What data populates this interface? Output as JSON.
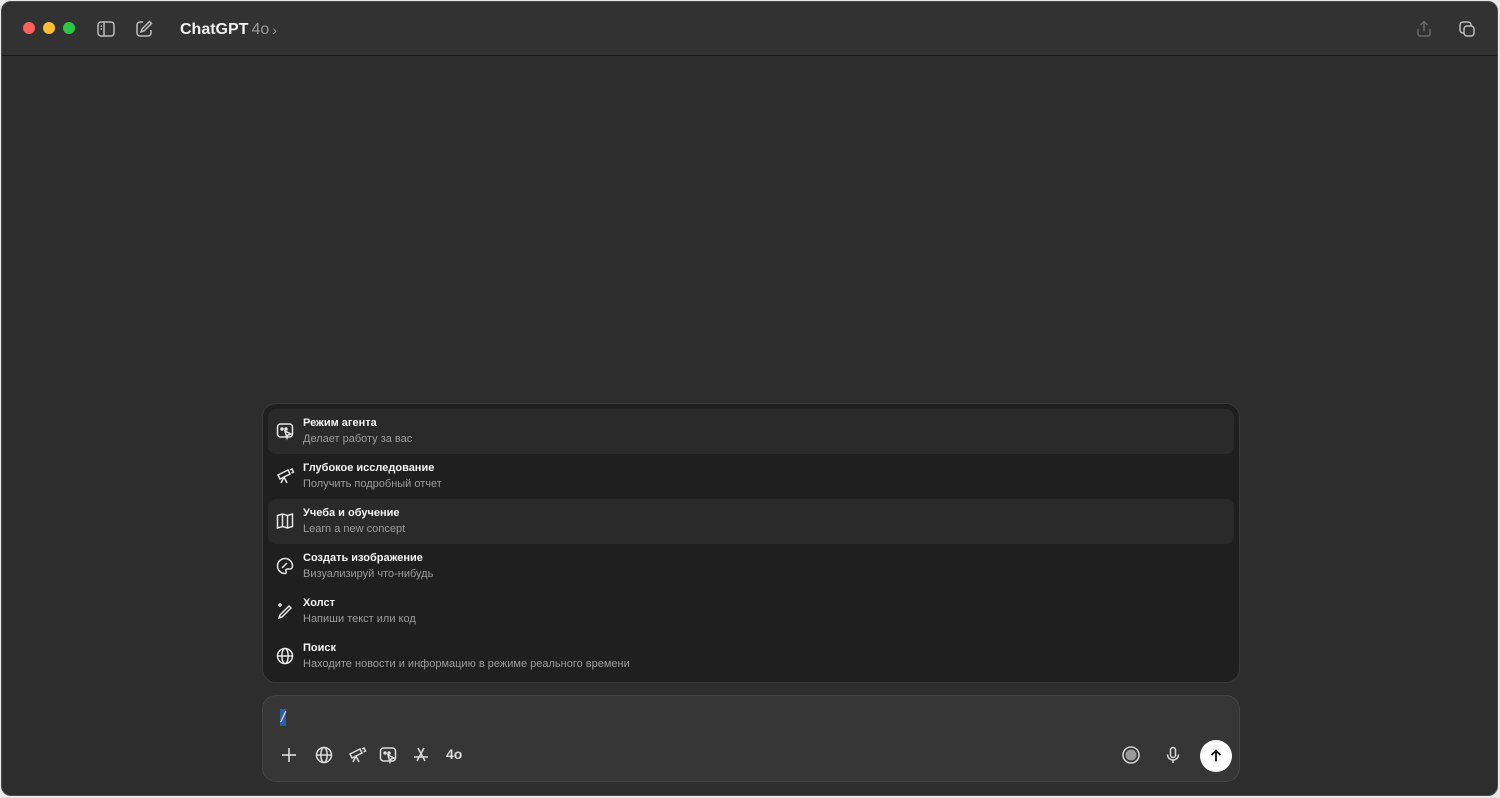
{
  "window": {
    "traffic_lights": [
      "#ff5f57",
      "#febc2e",
      "#28c840"
    ]
  },
  "titlebar": {
    "app_name": "ChatGPT",
    "model_version": "4o",
    "chevron": "›",
    "icons": [
      "sidebar-toggle-icon",
      "new-chat-icon",
      "share-icon",
      "copy-window-icon"
    ]
  },
  "command_menu": {
    "items": [
      {
        "title": "Режим агента",
        "subtitle": "Делает работу за вас",
        "icon": "agent-icon",
        "highlighted": true
      },
      {
        "title": "Глубокое исследование",
        "subtitle": "Получить подробный отчет",
        "icon": "telescope-icon",
        "highlighted": false
      },
      {
        "title": "Учеба и обучение",
        "subtitle": "Learn a new concept",
        "icon": "book-icon",
        "highlighted": true
      },
      {
        "title": "Создать изображение",
        "subtitle": "Визуализируй что-нибудь",
        "icon": "palette-icon",
        "highlighted": false
      },
      {
        "title": "Холст",
        "subtitle": "Напиши текст или код",
        "icon": "pencil-sparkle-icon",
        "highlighted": false
      },
      {
        "title": "Поиск",
        "subtitle": "Находите новости и информацию в режиме реального времени",
        "icon": "globe-icon",
        "highlighted": false
      }
    ]
  },
  "composer": {
    "input_value": "/",
    "model_label": "4o",
    "tool_icons": [
      "plus-icon",
      "globe-icon",
      "telescope-icon",
      "agent-icon",
      "app-store-icon"
    ],
    "right_icons": [
      "voice-mode-icon",
      "microphone-icon"
    ],
    "send_icon": "arrow-up-icon"
  }
}
